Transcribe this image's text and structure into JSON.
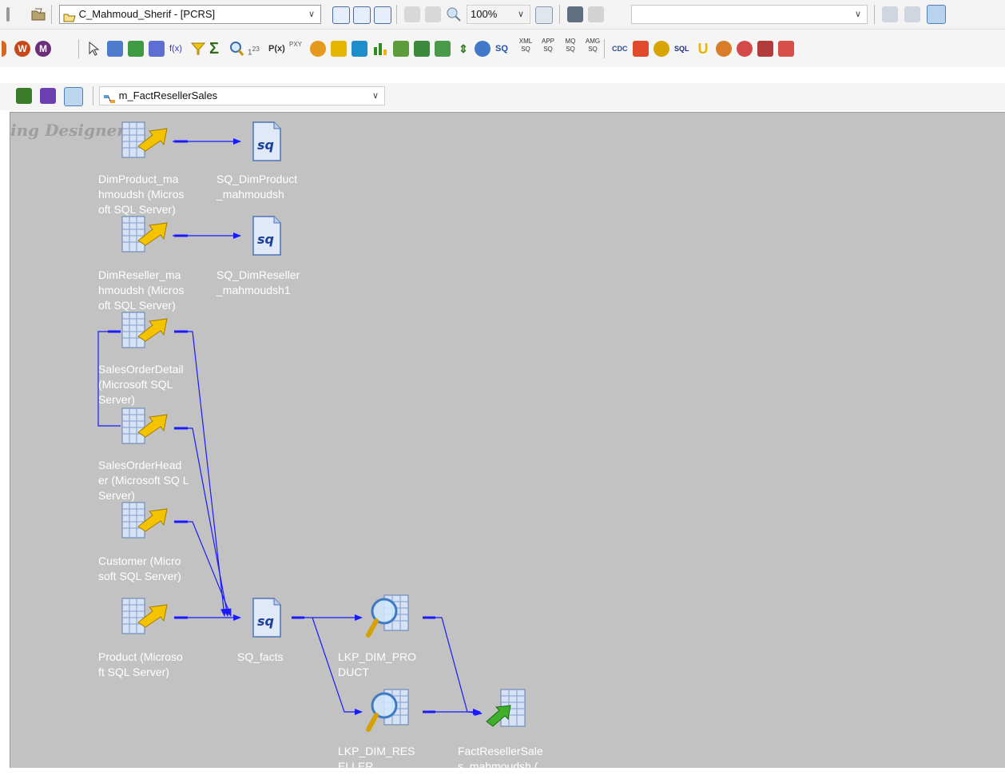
{
  "toolbar_top": {
    "repository_combo": {
      "value": "C_Mahmoud_Sherif - [PCRS]"
    },
    "zoom_combo": {
      "value": "100%"
    }
  },
  "toolbar_transform": {
    "buttons": [
      "arrow",
      "source",
      "target",
      "expression",
      "f(x)",
      "filter",
      "aggregator",
      "lookup",
      "sequence",
      "P(x)",
      "router",
      "joiner",
      "update",
      "rank",
      "normalizer",
      "sorter",
      "union",
      "source-qualifier",
      "xml-sq",
      "app-sq",
      "mq-sq",
      "amg-sq",
      "cdc",
      "custom",
      "sql",
      "union2",
      "stored-procedure",
      "mapplet",
      "transaction"
    ],
    "labels": {
      "sq": "SQ",
      "xml": "XML",
      "app": "APP",
      "mq": "MQ",
      "amg": "AMG",
      "sq_small": "SQ",
      "sql": "SQL",
      "pxy": "PXY"
    }
  },
  "toolbar_mapping": {
    "mapping_combo": {
      "value": "m_FactResellerSales"
    }
  },
  "canvas": {
    "title": "ping Designer",
    "nodes": {
      "dimproduct": {
        "label": "DimProduct_ma\nhmoudsh (Micros\noft SQL Server)"
      },
      "sq_dimproduct": {
        "label": "SQ_DimProduct\n_mahmoudsh"
      },
      "dimreseller": {
        "label": "DimReseller_ma\nhmoudsh (Micros\noft SQL Server)"
      },
      "sq_dimreseller": {
        "label": "SQ_DimReseller\n_mahmoudsh1"
      },
      "salesorderdetail": {
        "label": "SalesOrderDetail\n(Microsoft SQL\nServer)"
      },
      "salesorderheader": {
        "label": "SalesOrderHead\ner (Microsoft SQ L\nServer)"
      },
      "customer": {
        "label": "Customer (Micro\nsoft SQL Server)"
      },
      "product": {
        "label": "Product (Microso\nft SQL Server)"
      },
      "sq_facts": {
        "label": "SQ_facts"
      },
      "lkp_dim_product": {
        "label": "LKP_DIM_PRO\nDUCT"
      },
      "lkp_dim_reseller": {
        "label": "LKP_DIM_RES\nELLER"
      },
      "fact_target": {
        "label": "FactResellerSale\ns_mahmoudsh ("
      }
    }
  },
  "colors": {
    "canvas": "#c2c2c2",
    "link": "#1a1aff",
    "source_yellow": "#f4c300",
    "target_green": "#3fae2a"
  }
}
